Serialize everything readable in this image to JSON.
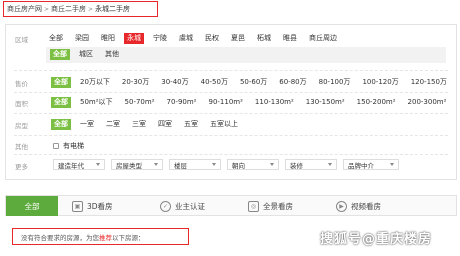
{
  "breadcrumb": {
    "items": [
      "商丘房产网",
      "商丘二手房",
      "永城二手房"
    ],
    "separator": ">"
  },
  "filters": {
    "region": {
      "label": "区域",
      "options": [
        "全部",
        "梁园",
        "睢阳",
        "永城",
        "宁陵",
        "虞城",
        "民权",
        "夏邑",
        "柘城",
        "睢县",
        "商丘周边"
      ],
      "active": "永城"
    },
    "subregion": {
      "options": [
        "全部",
        "城区",
        "其他"
      ],
      "active": "全部"
    },
    "price": {
      "label": "售价",
      "options": [
        "全部",
        "20万以下",
        "20-30万",
        "30-40万",
        "40-50万",
        "50-60万",
        "60-80万",
        "80-100万",
        "100-120万",
        "120-150万"
      ],
      "active": "全部"
    },
    "area": {
      "label": "面积",
      "options": [
        "全部",
        "50m²以下",
        "50-70m²",
        "70-90m²",
        "90-110m²",
        "110-130m²",
        "130-150m²",
        "150-200m²",
        "200-300m²"
      ],
      "active": "全部"
    },
    "layout": {
      "label": "房型",
      "options": [
        "全部",
        "一室",
        "二室",
        "三室",
        "四室",
        "五室",
        "五室以上"
      ],
      "active": "全部"
    },
    "other": {
      "label": "其他",
      "checkbox_label": "有电梯"
    },
    "more": {
      "label": "更多",
      "dropdowns": [
        "建造年代",
        "房屋类型",
        "楼层",
        "朝向",
        "装修",
        "品牌中介"
      ]
    }
  },
  "tabs": [
    {
      "label": "全部",
      "icon": ""
    },
    {
      "label": "3D看房",
      "icon": "3d-view-icon"
    },
    {
      "label": "业主认证",
      "icon": "verified-icon"
    },
    {
      "label": "全景看房",
      "icon": "panorama-icon"
    },
    {
      "label": "视频看房",
      "icon": "video-icon"
    }
  ],
  "notice": {
    "before": "没有符合要求的房源，为您",
    "highlight": "推荐",
    "after": "以下房源："
  },
  "watermark": "搜狐号@重庆楼房",
  "colors": {
    "accent_green": "#7bc043",
    "tab_green": "#5cab3c",
    "highlight_red": "#e8272a"
  }
}
